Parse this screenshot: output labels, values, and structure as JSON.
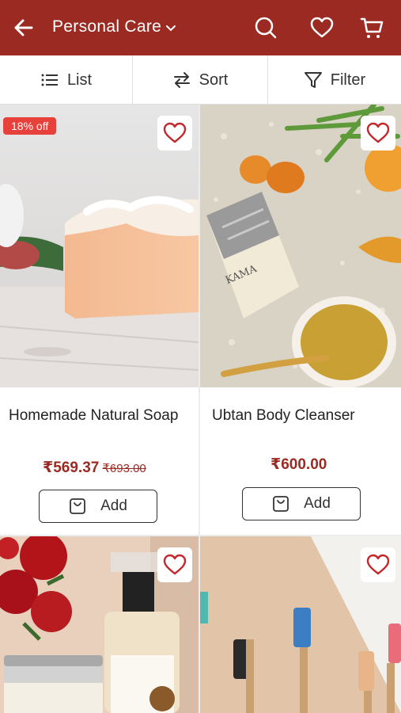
{
  "header": {
    "title": "Personal Care",
    "back_icon": "arrow-left-icon",
    "search_icon": "search-icon",
    "wishlist_icon": "heart-icon",
    "cart_icon": "cart-icon",
    "background": "#9b2a22"
  },
  "toolbar": {
    "list_label": "List",
    "sort_label": "Sort",
    "filter_label": "Filter"
  },
  "products": [
    {
      "name": "Homemade Natural Soap",
      "price": "₹569.37",
      "mrp": "₹693.00",
      "discount_badge": "18% off",
      "add_label": "Add"
    },
    {
      "name": "Ubtan Body Cleanser",
      "price": "₹600.00",
      "add_label": "Add"
    },
    {
      "name": ""
    },
    {
      "name": ""
    }
  ],
  "colors": {
    "accent": "#9b2a22",
    "badge": "#e8403a",
    "heart": "#c3282c"
  }
}
